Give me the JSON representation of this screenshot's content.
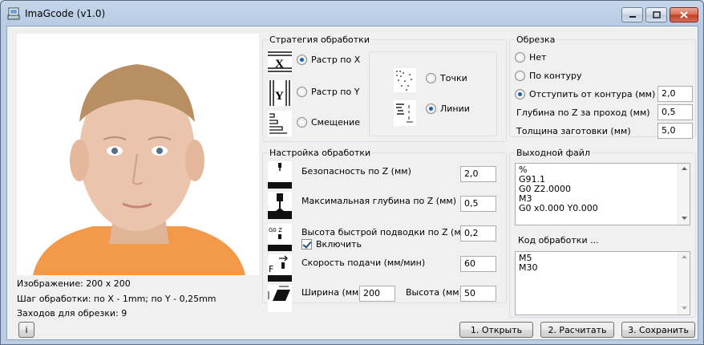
{
  "window": {
    "title": "ImaGcode (v1.0)"
  },
  "image_info": {
    "size": "Изображение: 200 x 200",
    "step": "Шаг обработки: по X - 1mm; по Y - 0,25mm",
    "passes": "Заходов для обрезки: 9"
  },
  "strategy": {
    "title": "Стратегия обработки",
    "options": [
      {
        "label": "Растр по X",
        "selected": true
      },
      {
        "label": "Растр по Y",
        "selected": false
      },
      {
        "label": "Смещение",
        "selected": false
      }
    ],
    "mode": [
      {
        "label": "Точки",
        "selected": false
      },
      {
        "label": "Линии",
        "selected": true
      }
    ]
  },
  "trim": {
    "title": "Обрезка",
    "options": [
      {
        "label": "Нет",
        "selected": false
      },
      {
        "label": "По контуру",
        "selected": false
      },
      {
        "label": "Отступить от контура (мм)",
        "selected": true
      }
    ],
    "offset_value": "2,0",
    "depth_label": "Глубина по Z за проход (мм)",
    "depth_value": "0,5",
    "thickness_label": "Толщина заготовки (мм)",
    "thickness_value": "5,0"
  },
  "settings": {
    "title": "Настройка обработки",
    "safe_z_label": "Безопасность по Z (мм)",
    "safe_z_value": "2,0",
    "max_depth_label": "Максимальная глубина по Z (мм)",
    "max_depth_value": "0,5",
    "rapid_label": "Высота быстрой подводки по Z (мм)",
    "rapid_value": "0,2",
    "rapid_enable_label": "Включить",
    "rapid_enabled": true,
    "feed_label": "Скорость подачи (мм/мин)",
    "feed_value": "60",
    "width_label": "Ширина (мм)",
    "width_value": "200",
    "height_label": "Высота (мм)",
    "height_value": "50",
    "icon_g0_text": "G0 Z",
    "icon_f_text": "F"
  },
  "output": {
    "title": "Выходной файл",
    "lines": [
      "%",
      "G91.1",
      "G0 Z2.0000",
      "M3",
      "G0 x0.000 Y0.000"
    ],
    "footer_title": "Код обработки ...",
    "footer_lines": [
      "M5",
      "M30"
    ]
  },
  "buttons": {
    "info": "i",
    "open": "1. Открыть",
    "calc": "2. Расчитать",
    "save": "3. Сохранить"
  },
  "colors": {
    "accent": "#1d5fa8",
    "close": "#c23c1c",
    "skin": "#e9c2a8",
    "shirt": "#f29a4a",
    "hair": "#b88f62"
  }
}
